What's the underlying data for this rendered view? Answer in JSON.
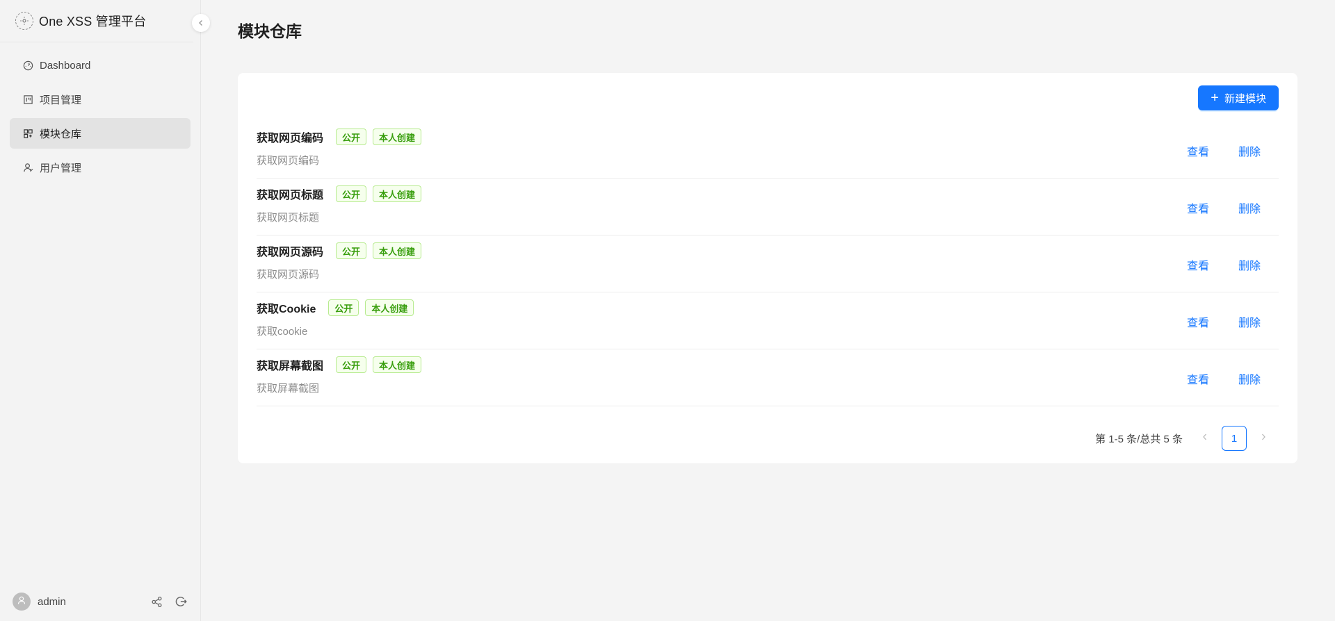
{
  "app": {
    "title": "One XSS 管理平台"
  },
  "sidebar": {
    "items": [
      {
        "label": "Dashboard",
        "icon": "dashboard-icon"
      },
      {
        "label": "项目管理",
        "icon": "project-icon"
      },
      {
        "label": "模块仓库",
        "icon": "appstore-icon",
        "active": true
      },
      {
        "label": "用户管理",
        "icon": "user-management-icon"
      }
    ],
    "footer": {
      "username": "admin"
    }
  },
  "page": {
    "title": "模块仓库"
  },
  "toolbar": {
    "new_label": "新建模块"
  },
  "modules": [
    {
      "title": "获取网页编码",
      "desc": "获取网页编码",
      "tags": [
        "公开",
        "本人创建"
      ],
      "view": "查看",
      "delete": "删除"
    },
    {
      "title": "获取网页标题",
      "desc": "获取网页标题",
      "tags": [
        "公开",
        "本人创建"
      ],
      "view": "查看",
      "delete": "删除"
    },
    {
      "title": "获取网页源码",
      "desc": "获取网页源码",
      "tags": [
        "公开",
        "本人创建"
      ],
      "view": "查看",
      "delete": "删除"
    },
    {
      "title": "获取Cookie",
      "desc": "获取cookie",
      "tags": [
        "公开",
        "本人创建"
      ],
      "view": "查看",
      "delete": "删除"
    },
    {
      "title": "获取屏幕截图",
      "desc": "获取屏幕截图",
      "tags": [
        "公开",
        "本人创建"
      ],
      "view": "查看",
      "delete": "删除"
    }
  ],
  "pagination": {
    "summary": "第 1-5 条/总共 5 条",
    "current": "1"
  },
  "colors": {
    "primary": "#1677ff",
    "tag_green": "#389e0d",
    "tag_bg": "#f6ffed",
    "tag_border": "#b7eb8f"
  }
}
